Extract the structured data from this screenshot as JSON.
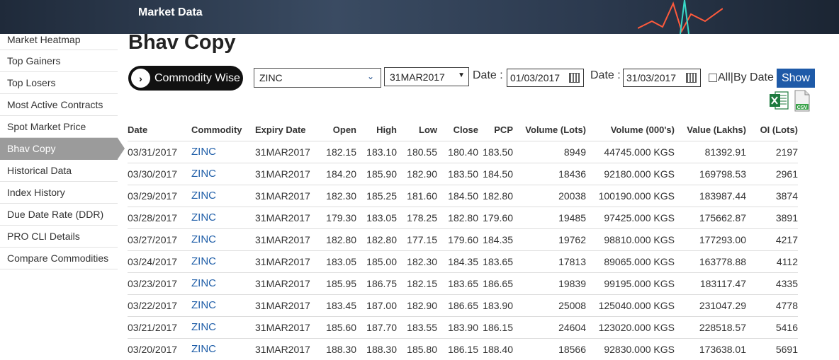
{
  "banner": {
    "title": "Market Data"
  },
  "sidebar": {
    "items": [
      {
        "label": "Market Heatmap"
      },
      {
        "label": "Top Gainers"
      },
      {
        "label": "Top Losers"
      },
      {
        "label": "Most Active Contracts"
      },
      {
        "label": "Spot Market Price"
      },
      {
        "label": "Bhav Copy",
        "active": true
      },
      {
        "label": "Historical Data"
      },
      {
        "label": "Index History"
      },
      {
        "label": "Due Date Rate (DDR)"
      },
      {
        "label": "PRO CLI Details"
      },
      {
        "label": "Compare Commodities"
      }
    ]
  },
  "page": {
    "title": "Bhav Copy"
  },
  "filters": {
    "mode_label": "Commodity Wise",
    "commodity_value": "ZINC",
    "expiry_value": "31MAR2017",
    "from_label": "Date :",
    "from_value": "01/03/2017",
    "to_label": "Date :",
    "to_value": "31/03/2017",
    "all_by_date_label": "All|By Date",
    "show_label": "Show",
    "export_excel_icon": "excel-icon",
    "export_csv_icon": "csv-icon"
  },
  "table": {
    "headers": [
      "Date",
      "Commodity",
      "Expiry Date",
      "Open",
      "High",
      "Low",
      "Close",
      "PCP",
      "Volume (Lots)",
      "Volume (000's)",
      "Value (Lakhs)",
      "OI (Lots)"
    ],
    "rows": [
      [
        "03/31/2017",
        "ZINC",
        "31MAR2017",
        "182.15",
        "183.10",
        "180.55",
        "180.40",
        "183.50",
        "8949",
        "44745.000 KGS",
        "81392.91",
        "2197"
      ],
      [
        "03/30/2017",
        "ZINC",
        "31MAR2017",
        "184.20",
        "185.90",
        "182.90",
        "183.50",
        "184.50",
        "18436",
        "92180.000 KGS",
        "169798.53",
        "2961"
      ],
      [
        "03/29/2017",
        "ZINC",
        "31MAR2017",
        "182.30",
        "185.25",
        "181.60",
        "184.50",
        "182.80",
        "20038",
        "100190.000 KGS",
        "183987.44",
        "3874"
      ],
      [
        "03/28/2017",
        "ZINC",
        "31MAR2017",
        "179.30",
        "183.05",
        "178.25",
        "182.80",
        "179.60",
        "19485",
        "97425.000 KGS",
        "175662.87",
        "3891"
      ],
      [
        "03/27/2017",
        "ZINC",
        "31MAR2017",
        "182.80",
        "182.80",
        "177.15",
        "179.60",
        "184.35",
        "19762",
        "98810.000 KGS",
        "177293.00",
        "4217"
      ],
      [
        "03/24/2017",
        "ZINC",
        "31MAR2017",
        "183.05",
        "185.00",
        "182.30",
        "184.35",
        "183.65",
        "17813",
        "89065.000 KGS",
        "163778.88",
        "4112"
      ],
      [
        "03/23/2017",
        "ZINC",
        "31MAR2017",
        "185.95",
        "186.75",
        "182.15",
        "183.65",
        "186.65",
        "19839",
        "99195.000 KGS",
        "183117.47",
        "4335"
      ],
      [
        "03/22/2017",
        "ZINC",
        "31MAR2017",
        "183.45",
        "187.00",
        "182.90",
        "186.65",
        "183.90",
        "25008",
        "125040.000 KGS",
        "231047.29",
        "4778"
      ],
      [
        "03/21/2017",
        "ZINC",
        "31MAR2017",
        "185.60",
        "187.70",
        "183.55",
        "183.90",
        "186.15",
        "24604",
        "123020.000 KGS",
        "228518.57",
        "5416"
      ],
      [
        "03/20/2017",
        "ZINC",
        "31MAR2017",
        "188.30",
        "188.30",
        "185.80",
        "186.15",
        "188.40",
        "18566",
        "92830.000 KGS",
        "173638.01",
        "5691"
      ]
    ]
  }
}
